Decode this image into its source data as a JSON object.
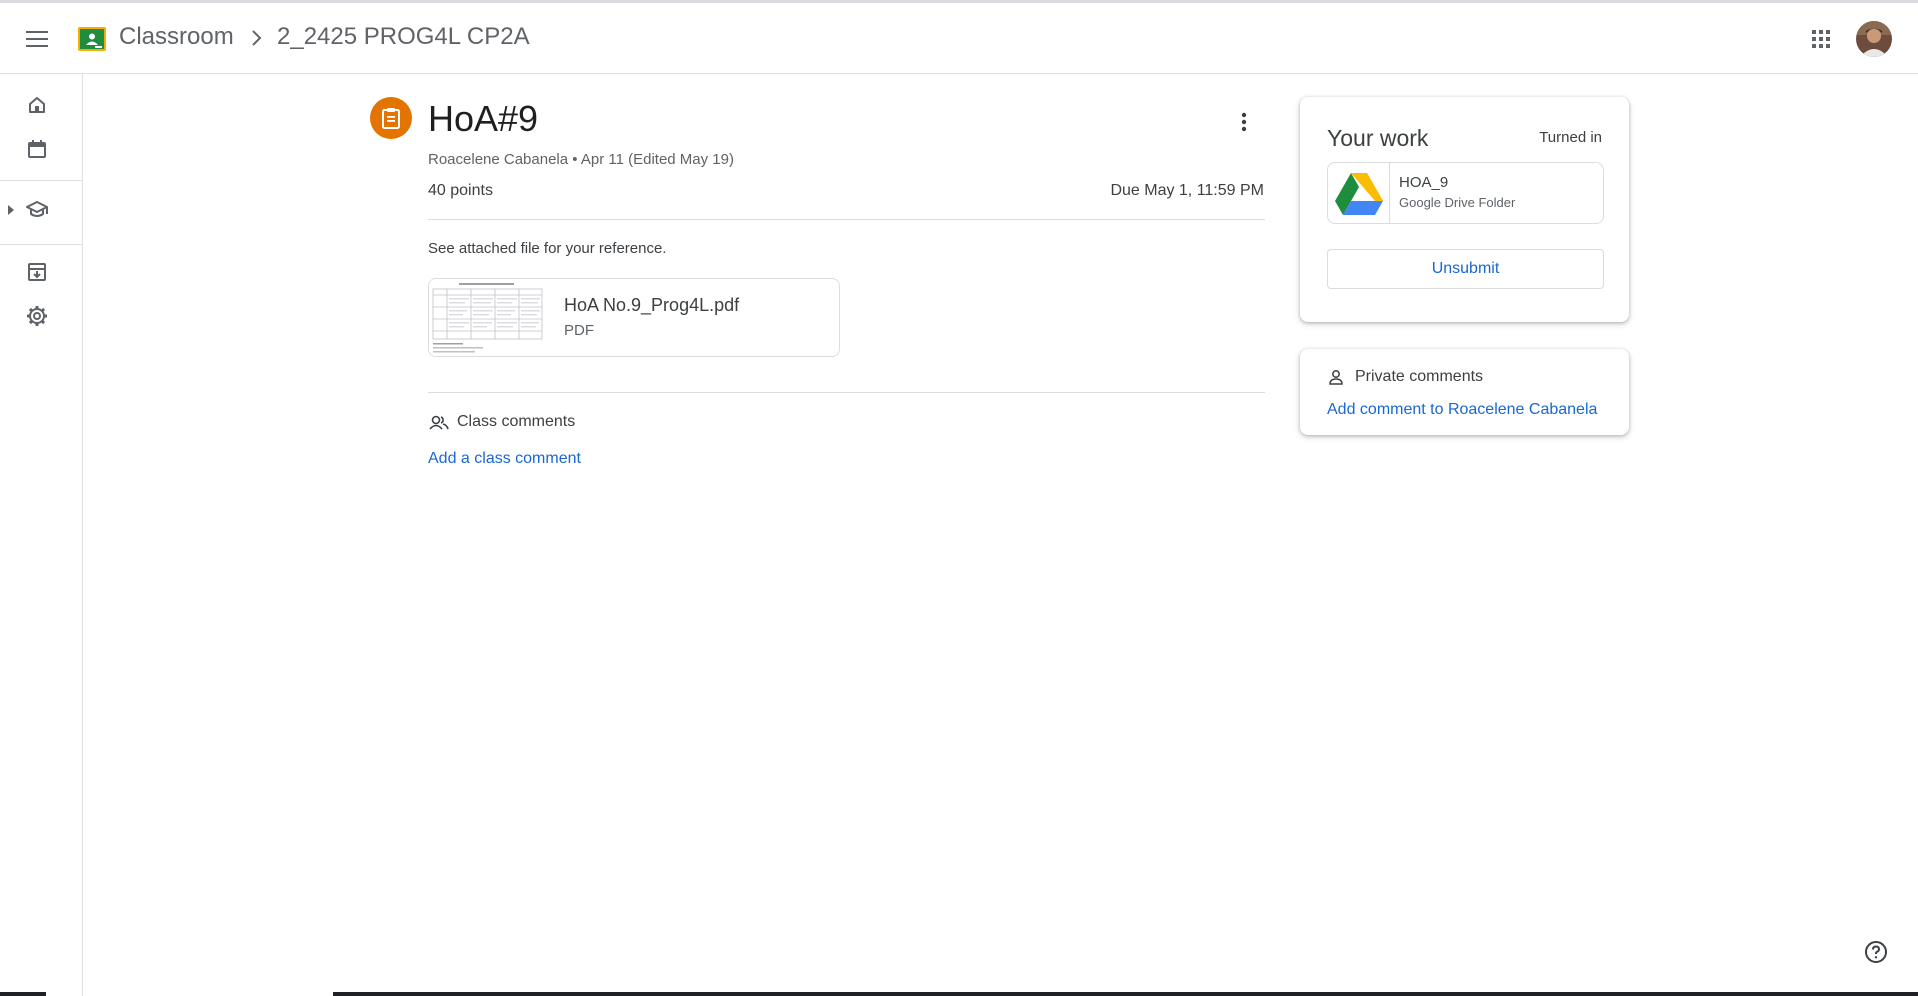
{
  "header": {
    "app_name": "Classroom",
    "class_name": "2_2425 PROG4L CP2A"
  },
  "assignment": {
    "title": "HoA#9",
    "meta": "Roacelene Cabanela • Apr 11 (Edited May 19)",
    "points": "40 points",
    "due": "Due May 1, 11:59 PM",
    "description": "See attached file for your reference.",
    "attachment": {
      "name": "HoA No.9_Prog4L.pdf",
      "type": "PDF"
    }
  },
  "class_comments": {
    "label": "Class comments",
    "add_label": "Add a class comment"
  },
  "your_work": {
    "title": "Your work",
    "status": "Turned in",
    "file": {
      "name": "HOA_9",
      "type": "Google Drive Folder"
    },
    "unsubmit_label": "Unsubmit"
  },
  "private_comments": {
    "label": "Private comments",
    "add_label": "Add comment to Roacelene Cabanela"
  },
  "colors": {
    "accent": "#1967d2",
    "assignment_icon": "#e37400",
    "classroom_logo": "#1e8e3e"
  },
  "icons": {
    "menu": "menu-icon",
    "home": "home-icon",
    "calendar": "calendar-icon",
    "enrolled": "school-icon",
    "archive": "archive-icon",
    "settings": "gear-icon",
    "apps": "apps-grid-icon",
    "help": "help-icon"
  }
}
